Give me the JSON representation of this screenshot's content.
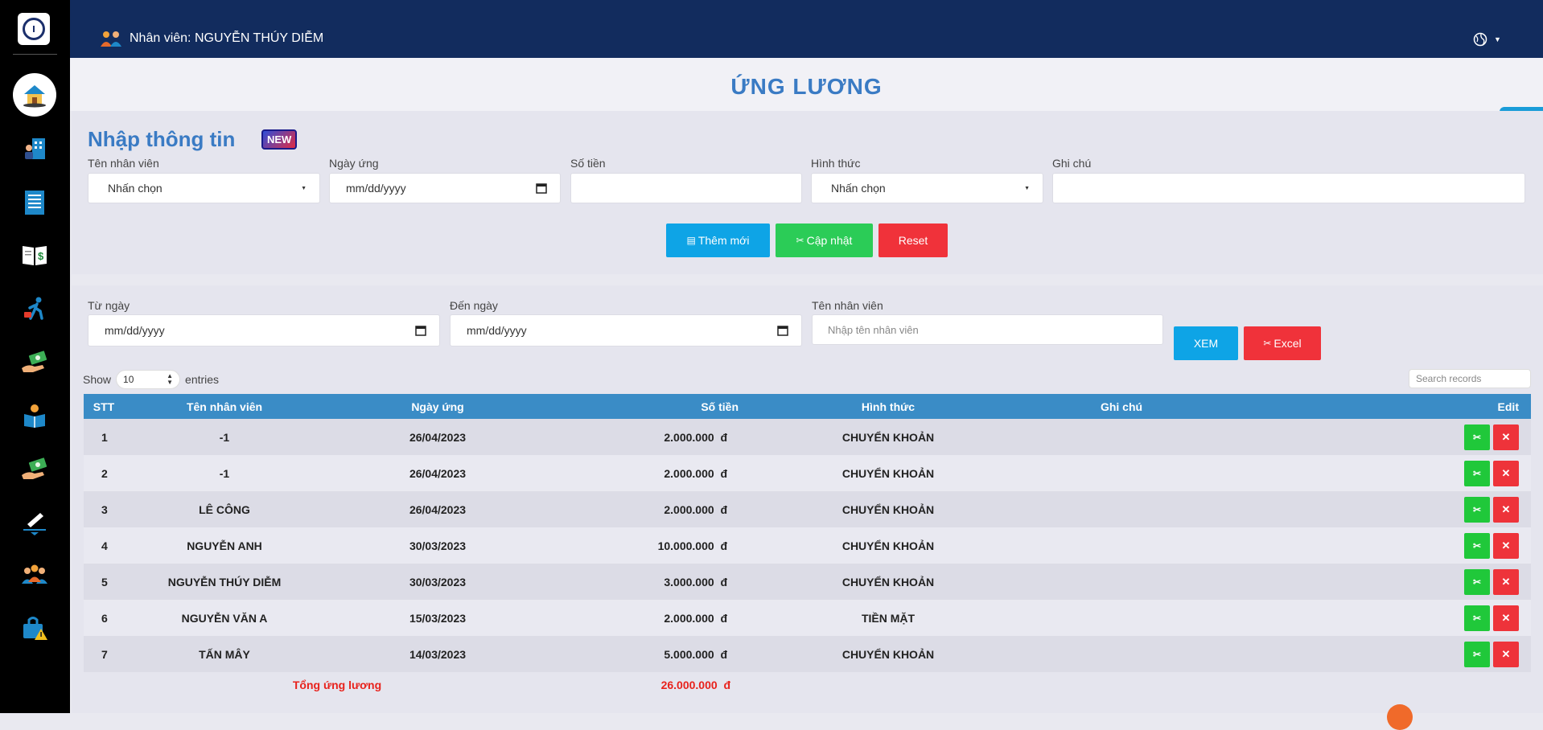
{
  "header": {
    "user_label": "Nhân viên: NGUYỄN THÚY DIỄM"
  },
  "sidebar": {
    "items": [
      {
        "icon": "home-icon"
      },
      {
        "icon": "office-staff-icon"
      },
      {
        "icon": "document-list-icon"
      },
      {
        "icon": "money-book-icon"
      },
      {
        "icon": "person-walking-icon"
      },
      {
        "icon": "cash-hand-icon"
      },
      {
        "icon": "reading-person-icon"
      },
      {
        "icon": "cash-hand-icon"
      },
      {
        "icon": "signature-pen-icon"
      },
      {
        "icon": "group-people-icon"
      },
      {
        "icon": "briefcase-warning-icon"
      }
    ]
  },
  "page": {
    "title": "ỨNG LƯƠNG"
  },
  "form": {
    "title": "Nhập thông tin",
    "badge": "NEW",
    "employee_label": "Tên nhân viên",
    "employee_value": "Nhấn chọn",
    "date_label": "Ngày ứng",
    "date_placeholder": "mm/dd/yyyy",
    "amount_label": "Số tiền",
    "method_label": "Hình thức",
    "method_value": "Nhấn chọn",
    "note_label": "Ghi chú",
    "add_button": "Thêm mới",
    "update_button": "Cập nhật",
    "reset_button": "Reset"
  },
  "filter": {
    "from_label": "Từ ngày",
    "from_placeholder": "mm/dd/yyyy",
    "to_label": "Đến ngày",
    "to_placeholder": "mm/dd/yyyy",
    "employee_label": "Tên nhân viên",
    "employee_placeholder": "Nhập tên nhân viên",
    "view_button": "XEM",
    "excel_button": "Excel"
  },
  "table": {
    "show_label": "Show",
    "entries_value": "10",
    "entries_label": "entries",
    "search_placeholder": "Search records",
    "columns": [
      "STT",
      "Tên nhân viên",
      "Ngày ứng",
      "Số tiền",
      "Hình thức",
      "Ghi chú",
      "Edit"
    ],
    "currency": "đ",
    "rows": [
      {
        "stt": "1",
        "name": "-1",
        "date": "26/04/2023",
        "amount": "2.000.000",
        "method": "CHUYỂN KHOẢN",
        "note": ""
      },
      {
        "stt": "2",
        "name": "-1",
        "date": "26/04/2023",
        "amount": "2.000.000",
        "method": "CHUYỂN KHOẢN",
        "note": ""
      },
      {
        "stt": "3",
        "name": "LÊ CÔNG",
        "date": "26/04/2023",
        "amount": "2.000.000",
        "method": "CHUYỂN KHOẢN",
        "note": ""
      },
      {
        "stt": "4",
        "name": "NGUYỄN ANH",
        "date": "30/03/2023",
        "amount": "10.000.000",
        "method": "CHUYỂN KHOẢN",
        "note": ""
      },
      {
        "stt": "5",
        "name": "NGUYỄN THÚY DIỄM",
        "date": "30/03/2023",
        "amount": "3.000.000",
        "method": "CHUYỂN KHOẢN",
        "note": ""
      },
      {
        "stt": "6",
        "name": "NGUYỄN VĂN A",
        "date": "15/03/2023",
        "amount": "2.000.000",
        "method": "TIỀN MẶT",
        "note": ""
      },
      {
        "stt": "7",
        "name": "TẤN MÂY",
        "date": "14/03/2023",
        "amount": "5.000.000",
        "method": "CHUYỂN KHOẢN",
        "note": ""
      }
    ],
    "total_label": "Tổng ứng lương",
    "total_value": "26.000.000"
  },
  "colors": {
    "topbar": "#122c5e",
    "title": "#3a7bc4",
    "table_header": "#3a8cc6",
    "total": "#e8221c"
  }
}
